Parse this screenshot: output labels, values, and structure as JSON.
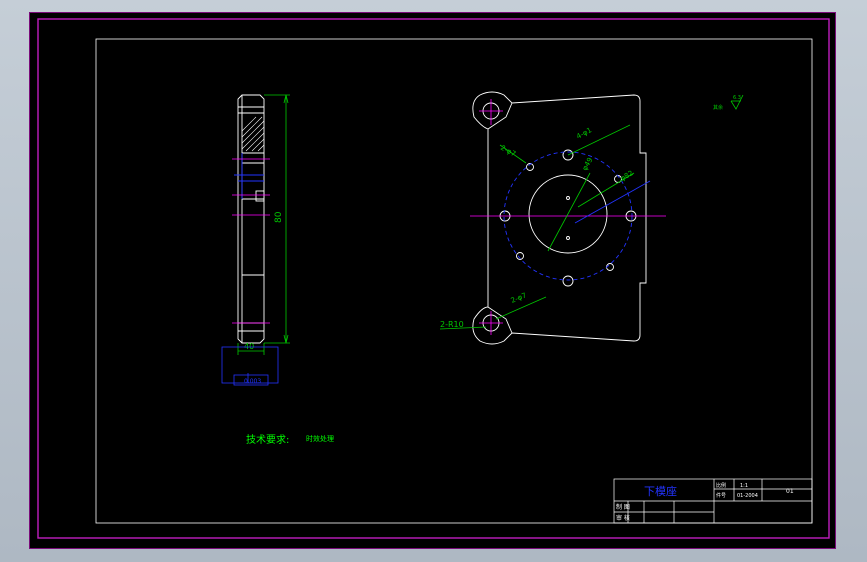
{
  "part_name": "下模座",
  "tech_req_label": "技术要求:",
  "tech_req_text": "时效处理",
  "dims": {
    "height": "80",
    "thickness": "40",
    "slot": "2-φ7",
    "hole4": "4-φ1",
    "circle_big": "φ49",
    "circle_pcd": "φ82",
    "hole_bottom": "2-φ7",
    "radius": "2-R10"
  },
  "flatness": "0.003",
  "roughness": "6.3",
  "roughness_prefix": "其余",
  "title_block": {
    "r1c1": "比例",
    "r1c2": "1:1",
    "r2c1": "件号",
    "r2c2": "01-2004",
    "sheet": "01",
    "designer": "制 图",
    "checker": "审 核"
  },
  "colors": {
    "background": "#000000",
    "border": "#c01ec0",
    "frame": "#ffffff",
    "dim": "#00c800",
    "center": "#ff00ff",
    "hidden": "#2233ff",
    "note": "#00ff00"
  }
}
